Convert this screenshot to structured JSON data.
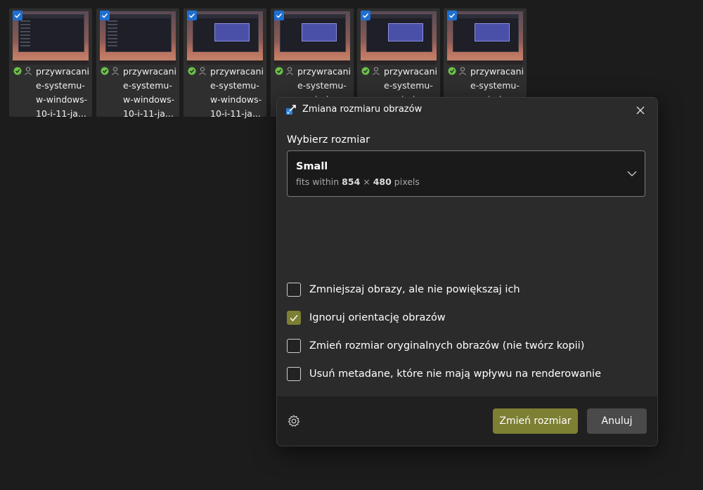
{
  "thumbnails": [
    {
      "label": "przywracanie-systemu-w-windows-10-i-11-ja..."
    },
    {
      "label": "przywracanie-systemu-w-windows-10-i-11-ja..."
    },
    {
      "label": "przywracanie-systemu-w-windows-10-i-11-ja..."
    },
    {
      "label": "przywracanie-systemu-w-windows-10-i-11-ja..."
    },
    {
      "label": "przywracanie-systemu-w-windows-10-i-11-ja..."
    },
    {
      "label": "przywracanie-systemu-w-windows-10-i-11-ja..."
    }
  ],
  "dialog": {
    "title": "Zmiana rozmiaru obrazów",
    "section_label": "Wybierz rozmiar",
    "size": {
      "name": "Small",
      "desc_prefix": "fits within",
      "width": "854",
      "times": "×",
      "height": "480",
      "unit": "pixels"
    },
    "options": [
      {
        "label": "Zmniejszaj obrazy, ale nie powiększaj ich",
        "checked": false
      },
      {
        "label": "Ignoruj orientację obrazów",
        "checked": true
      },
      {
        "label": "Zmień rozmiar oryginalnych obrazów (nie twórz kopii)",
        "checked": false
      },
      {
        "label": "Usuń metadane, które nie mają wpływu na renderowanie",
        "checked": false
      }
    ],
    "primary_button": "Zmień rozmiar",
    "secondary_button": "Anuluj"
  },
  "colors": {
    "accent": "#7d7f33",
    "selection_blue": "#1f6fd0",
    "status_green": "#6cc04a"
  },
  "icons": {
    "title": "image-resizer-icon",
    "close": "close-icon",
    "chevron": "chevron-down-icon",
    "settings": "gear-icon",
    "status": "check-circle-icon",
    "person": "person-icon"
  }
}
